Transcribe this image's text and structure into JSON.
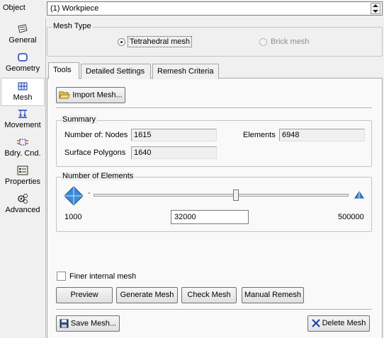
{
  "object": {
    "label": "Object",
    "value": "(1) Workpiece"
  },
  "sidebar": {
    "items": [
      {
        "label": "General",
        "icon": "general-icon"
      },
      {
        "label": "Geometry",
        "icon": "geometry-icon"
      },
      {
        "label": "Mesh",
        "icon": "mesh-icon",
        "active": true
      },
      {
        "label": "Movement",
        "icon": "movement-icon"
      },
      {
        "label": "Bdry. Cnd.",
        "icon": "boundary-condition-icon"
      },
      {
        "label": "Properties",
        "icon": "properties-icon"
      },
      {
        "label": "Advanced",
        "icon": "advanced-icon"
      }
    ]
  },
  "mesh_type": {
    "title": "Mesh Type",
    "options": [
      {
        "label": "Tetrahedral mesh",
        "selected": true,
        "enabled": true
      },
      {
        "label": "Brick mesh",
        "selected": false,
        "enabled": false
      }
    ]
  },
  "tabs": [
    {
      "label": "Tools",
      "active": true
    },
    {
      "label": "Detailed Settings",
      "active": false
    },
    {
      "label": "Remesh Criteria",
      "active": false
    }
  ],
  "tools": {
    "import_label": "Import Mesh...",
    "summary": {
      "title": "Summary",
      "nodes_label": "Number of: Nodes",
      "nodes_value": "1615",
      "elements_label": "Elements",
      "elements_value": "6948",
      "polygons_label": "Surface Polygons",
      "polygons_value": "1640"
    },
    "number_of_elements": {
      "title": "Number of Elements",
      "min_label": "1000",
      "max_label": "500000",
      "value": "32000",
      "slider_min": 1000,
      "slider_max": 500000,
      "slider_value": 32000
    },
    "finer_mesh_label": "Finer internal mesh",
    "finer_mesh_checked": false,
    "buttons": {
      "preview": "Preview",
      "generate": "Generate Mesh",
      "check": "Check Mesh",
      "manual_remesh": "Manual Remesh",
      "save": "Save Mesh...",
      "delete": "Delete Mesh"
    }
  }
}
